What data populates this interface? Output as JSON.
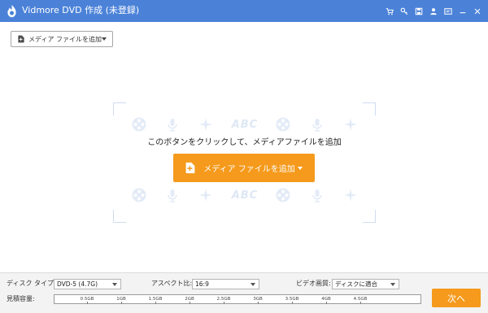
{
  "window": {
    "title": "Vidmore DVD 作成 (未登録)",
    "icons": [
      "cart-icon",
      "key-icon",
      "save-icon",
      "user-icon",
      "feedback-icon",
      "minimize-icon",
      "close-icon"
    ]
  },
  "toolbar": {
    "add_media_label": "メディア ファイルを追加"
  },
  "drop_area": {
    "hint": "このボタンをクリックして、メディアファイルを追加",
    "button_label": "メディア ファイルを追加",
    "decor_text": "ABC"
  },
  "settings": {
    "disc_type_label": "ディスク タイプ",
    "disc_type_value": "DVD-5 (4.7G)",
    "aspect_label": "アスペクト比:",
    "aspect_value": "16:9",
    "quality_label": "ビデオ画質:",
    "quality_value": "ディスクに適合",
    "capacity_label": "見積容量:"
  },
  "capacity": {
    "ticks": [
      "0.5GB",
      "1GB",
      "1.5GB",
      "2GB",
      "2.5GB",
      "3GB",
      "3.5GB",
      "4GB",
      "4.5GB"
    ]
  },
  "actions": {
    "next_label": "次へ"
  },
  "colors": {
    "titlebar": "#4b82d8",
    "accent": "#f59a1c",
    "decor": "#dfe8f5"
  }
}
